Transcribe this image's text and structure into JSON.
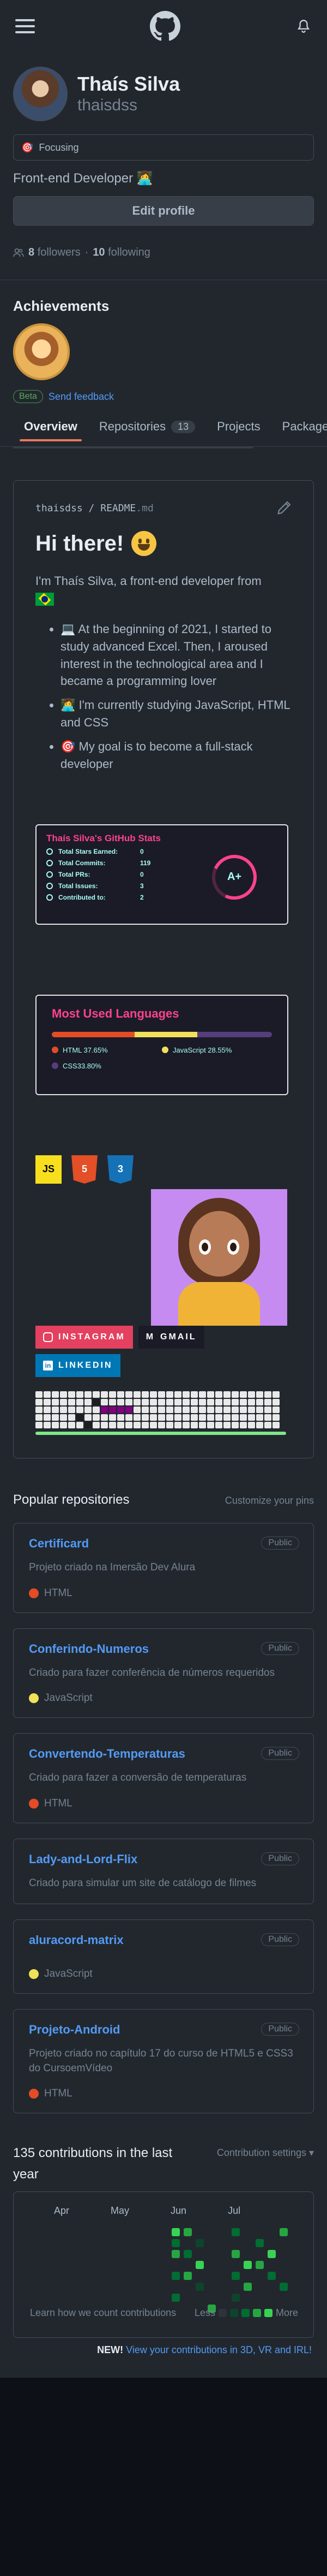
{
  "header": {
    "menu_icon": "hamburger-icon",
    "logo_icon": "github-logo-icon",
    "bell_icon": "bell-icon"
  },
  "profile": {
    "full_name": "Thaís Silva",
    "username": "thaisdss",
    "status_emoji": "🎯",
    "status": "Focusing",
    "bio": "Front-end Developer",
    "bio_emoji": "👩‍💻",
    "edit_label": "Edit profile",
    "followers_count": "8",
    "followers_label": "followers",
    "separator": "·",
    "following_count": "10",
    "following_label": "following"
  },
  "achievements": {
    "title": "Achievements",
    "beta": "Beta",
    "feedback": "Send feedback"
  },
  "tabs": [
    {
      "label": "Overview"
    },
    {
      "label": "Repositories",
      "count": "13"
    },
    {
      "label": "Projects"
    },
    {
      "label": "Packages"
    }
  ],
  "readme": {
    "user": "thaisdss",
    "sep": "/",
    "file": "README",
    "ext": ".md",
    "greeting": "Hi there!",
    "intro": "I'm Thaís Silva, a front-end developer from",
    "bullets": [
      {
        "emoji": "💻",
        "text": "At the beginning of 2021, I started to study advanced Excel. Then, I aroused interest in the technological area and I became a programming lover"
      },
      {
        "emoji": "👩‍💻",
        "text": "I'm currently studying JavaScript, HTML and CSS"
      },
      {
        "emoji": "🎯",
        "text": "My goal is to become a full-stack developer"
      }
    ],
    "stats": {
      "title": "Thaís Silva's GitHub Stats",
      "rows": [
        {
          "label": "Total Stars Earned:",
          "value": "0"
        },
        {
          "label": "Total Commits:",
          "value": "119"
        },
        {
          "label": "Total PRs:",
          "value": "0"
        },
        {
          "label": "Total Issues:",
          "value": "3"
        },
        {
          "label": "Contributed to:",
          "value": "2"
        }
      ],
      "grade": "A+"
    },
    "languages": {
      "title": "Most Used Languages",
      "items": [
        {
          "name": "HTML 37.65%",
          "pct": 37.65,
          "color": "#e34c26"
        },
        {
          "name": "JavaScript 28.55%",
          "pct": 28.55,
          "color": "#f1e05a"
        },
        {
          "name": "CSS33.80%",
          "pct": 33.8,
          "color": "#563d7c"
        }
      ]
    },
    "tech": [
      {
        "label": "JS",
        "bg": "#f7df1e",
        "fg": "#000000"
      },
      {
        "label": "5",
        "bg": "#e34f26",
        "fg": "#ffffff"
      },
      {
        "label": "3",
        "bg": "#1572b6",
        "fg": "#ffffff"
      }
    ],
    "socials": [
      {
        "label": "INSTAGRAM",
        "bg": "#e4405f"
      },
      {
        "label": "GMAIL",
        "bg": "#1a1b27"
      },
      {
        "label": "LINKEDIN",
        "bg": "#0077b5"
      }
    ]
  },
  "popular": {
    "title": "Popular repositories",
    "customize": "Customize your pins",
    "repos": [
      {
        "name": "Certificard",
        "visibility": "Public",
        "desc": "Projeto criado na Imersão Dev Alura",
        "lang": "HTML",
        "color": "#e34c26"
      },
      {
        "name": "Conferindo-Numeros",
        "visibility": "Public",
        "desc": "Criado para fazer conferência de números requeridos",
        "lang": "JavaScript",
        "color": "#f1e05a"
      },
      {
        "name": "Convertendo-Temperaturas",
        "visibility": "Public",
        "desc": "Criado para fazer a conversão de temperaturas",
        "lang": "HTML",
        "color": "#e34c26"
      },
      {
        "name": "Lady-and-Lord-Flix",
        "visibility": "Public",
        "desc": "Criado para simular um site de catálogo de filmes",
        "lang": "",
        "color": ""
      },
      {
        "name": "aluracord-matrix",
        "visibility": "Public",
        "desc": "",
        "lang": "JavaScript",
        "color": "#f1e05a"
      },
      {
        "name": "Projeto-Android",
        "visibility": "Public",
        "desc": "Projeto criado no capítulo 17 do curso de HTML5 e CSS3 do CursoemVídeo",
        "lang": "HTML",
        "color": "#e34c26"
      }
    ]
  },
  "contributions": {
    "title": "135 contributions in the last year",
    "settings": "Contribution settings ▾",
    "months": [
      "Apr",
      "May",
      "Jun",
      "Jul"
    ],
    "learn": "Learn how we count contributions",
    "less": "Less",
    "more": "More",
    "new_label": "NEW!",
    "new_link": "View your contributions in 3D, VR and IRL!",
    "legend_colors": [
      "#2d333b",
      "#0e4429",
      "#006d32",
      "#26a641",
      "#39d353"
    ]
  }
}
